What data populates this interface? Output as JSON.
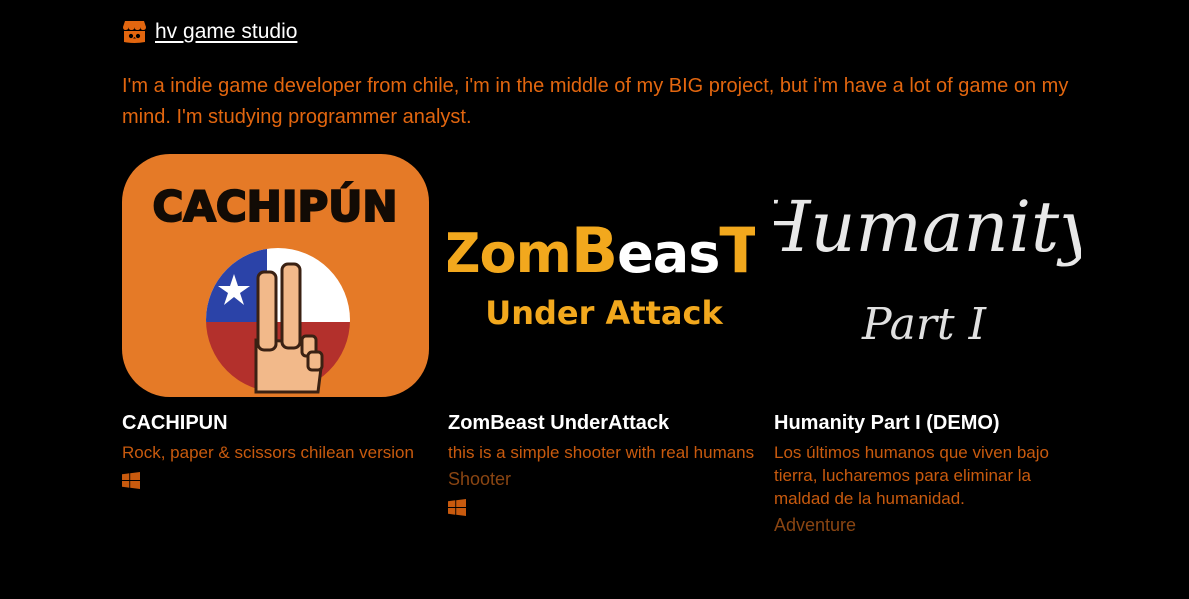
{
  "studio": {
    "name": "hv game studio",
    "bio": "I'm a indie game developer from chile, i'm in the middle of my BIG project, but i'm have a lot of game on my mind. I'm studying programmer analyst.",
    "icon": "itchio-store-icon"
  },
  "colors": {
    "background": "#000000",
    "accent": "#e2660f",
    "description": "#c85a0e",
    "genre": "#8a4512",
    "title": "#ffffff"
  },
  "games": [
    {
      "title": "CACHIPUN",
      "description": "Rock, paper & scissors chilean version",
      "genre": "",
      "platform": "windows-icon",
      "thumbnail_text": "CACHIPÚN"
    },
    {
      "title": "ZomBeast UnderAttack",
      "description": "this is a simple shooter with real humans",
      "genre": "Shooter",
      "platform": "windows-icon",
      "thumbnail_text": [
        "Zom",
        "B",
        "eas",
        "T"
      ],
      "thumbnail_subtext": "Under Attack"
    },
    {
      "title": "Humanity Part I (DEMO)",
      "description": "Los últimos humanos que viven bajo tierra, lucharemos para eliminar la maldad de la humanidad.",
      "genre": "Adventure",
      "platform": "",
      "thumbnail_text": "Humanity",
      "thumbnail_subtext": "Part I"
    }
  ]
}
